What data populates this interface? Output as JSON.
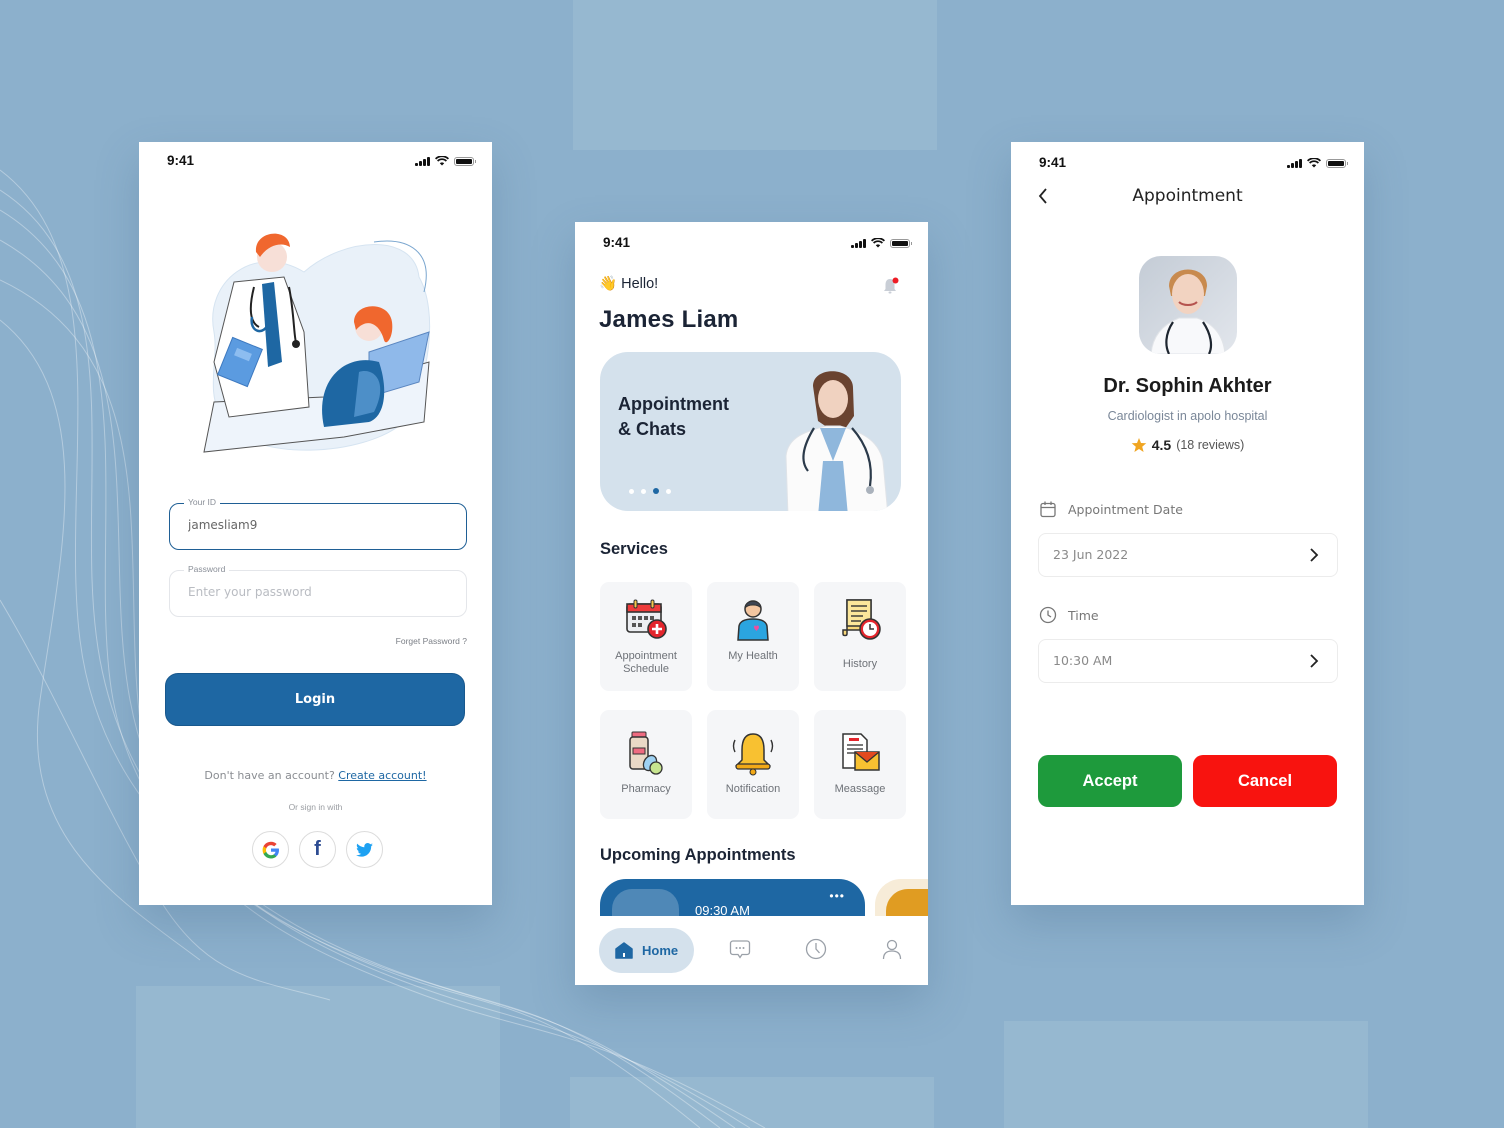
{
  "colors": {
    "background": "#8cb0cc",
    "primary": "#1e67a3",
    "accept": "#1e9a3c",
    "cancel": "#f8130f",
    "banner": "#d4e1ec",
    "tile": "#f5f6f8",
    "appointment_card_alt": "#e09c22"
  },
  "login_screen": {
    "status_time": "9:41",
    "illustration": "doctor-visiting-patient-illustration",
    "id_field": {
      "label": "Your ID",
      "value": "jamesliam9"
    },
    "password_field": {
      "label": "Password",
      "placeholder": "Enter your password"
    },
    "forgot_password": "Forget Password ?",
    "login_button": "Login",
    "no_account_text": "Don't have an account?",
    "create_account_link": "Create account!",
    "or_sign_in": "Or sign in with",
    "social": [
      {
        "name": "google",
        "icon": "G"
      },
      {
        "name": "facebook",
        "icon": "f"
      },
      {
        "name": "twitter",
        "icon": "twitter-bird"
      }
    ]
  },
  "home_screen": {
    "status_time": "9:41",
    "greeting_emoji": "👋",
    "greeting": "Hello!",
    "user_name": "James Liam",
    "banner": {
      "title": "Appointment & Chats",
      "slide_count": 4,
      "active_slide": 3
    },
    "services_title": "Services",
    "services": [
      {
        "label": "Appointment Schedule",
        "icon": "calendar-plus-icon"
      },
      {
        "label": "My Health",
        "icon": "person-heart-icon"
      },
      {
        "label": "History",
        "icon": "scroll-clock-icon"
      },
      {
        "label": "Pharmacy",
        "icon": "medicine-bottle-icon"
      },
      {
        "label": "Notification",
        "icon": "bell-icon"
      },
      {
        "label": "Meassage",
        "icon": "envelope-document-icon"
      }
    ],
    "upcoming_title": "Upcoming Appointments",
    "upcoming": [
      {
        "time": "09:30 AM",
        "menu": "•••"
      }
    ],
    "tabbar": {
      "home_label": "Home",
      "tabs": [
        "home",
        "chat",
        "history",
        "profile"
      ]
    }
  },
  "appointment_screen": {
    "status_time": "9:41",
    "title": "Appointment",
    "doctor": {
      "name": "Dr. Sophin Akhter",
      "specialty": "Cardiologist in apolo hospital",
      "rating": "4.5",
      "reviews": "(18 reviews)"
    },
    "date_label": "Appointment Date",
    "date_value": "23 Jun 2022",
    "time_label": "Time",
    "time_value": "10:30 AM",
    "accept_button": "Accept",
    "cancel_button": "Cancel"
  }
}
